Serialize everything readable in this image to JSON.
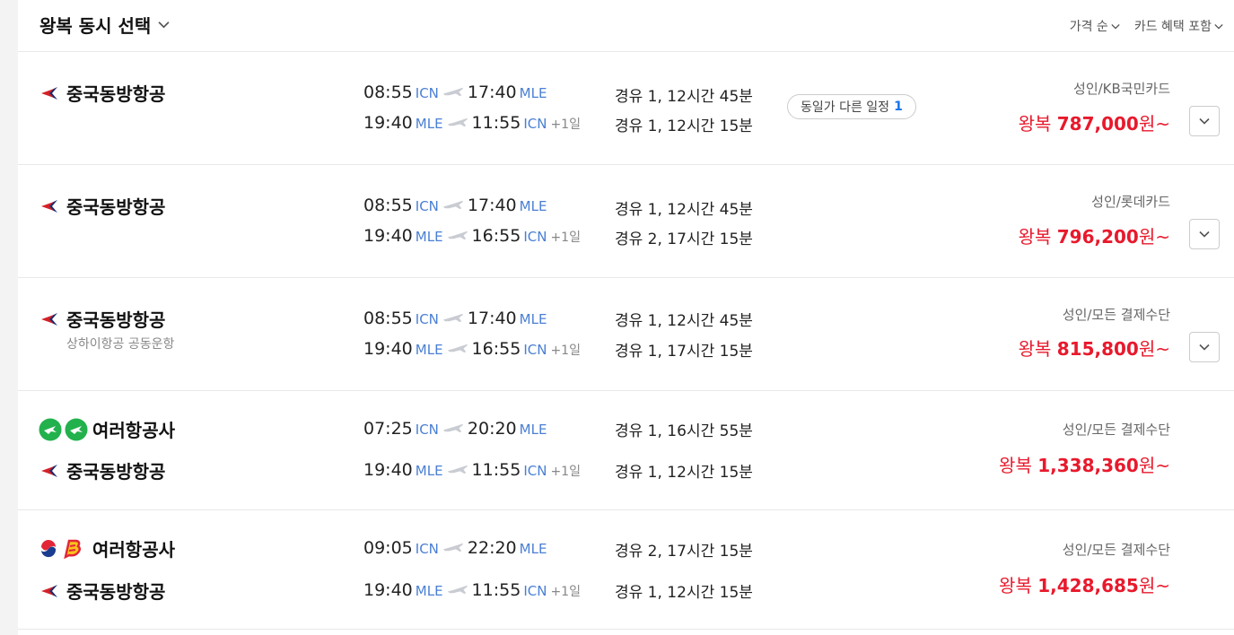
{
  "header": {
    "title": "왕복 동시 선택",
    "sort_label": "가격 순",
    "card_filter_label": "카드 혜택 포함"
  },
  "results": [
    {
      "airline": "중국동방항공",
      "outbound": {
        "dep_time": "08:55",
        "dep_code": "ICN",
        "arr_time": "17:40",
        "arr_code": "MLE",
        "plus": "",
        "stops": "경유 1, 12시간 45분"
      },
      "inbound": {
        "dep_time": "19:40",
        "dep_code": "MLE",
        "arr_time": "11:55",
        "arr_code": "ICN",
        "plus": "+1일",
        "stops": "경유 1, 12시간 15분"
      },
      "same_airline_label": "동일가 다른 일정",
      "same_airline_count": "1",
      "card": "성인/KB국민카드",
      "price_prefix": "왕복",
      "price": "787,000",
      "price_suffix": "원~"
    },
    {
      "airline": "중국동방항공",
      "outbound": {
        "dep_time": "08:55",
        "dep_code": "ICN",
        "arr_time": "17:40",
        "arr_code": "MLE",
        "plus": "",
        "stops": "경유 1, 12시간 45분"
      },
      "inbound": {
        "dep_time": "19:40",
        "dep_code": "MLE",
        "arr_time": "16:55",
        "arr_code": "ICN",
        "plus": "+1일",
        "stops": "경유 2, 17시간 15분"
      },
      "card": "성인/롯데카드",
      "price_prefix": "왕복",
      "price": "796,200",
      "price_suffix": "원~"
    },
    {
      "airline": "중국동방항공",
      "codeshare": "상하이항공 공동운항",
      "outbound": {
        "dep_time": "08:55",
        "dep_code": "ICN",
        "arr_time": "17:40",
        "arr_code": "MLE",
        "plus": "",
        "stops": "경유 1, 12시간 45분"
      },
      "inbound": {
        "dep_time": "19:40",
        "dep_code": "MLE",
        "arr_time": "16:55",
        "arr_code": "ICN",
        "plus": "+1일",
        "stops": "경유 1, 17시간 15분"
      },
      "card": "성인/모든 결제수단",
      "price_prefix": "왕복",
      "price": "815,800",
      "price_suffix": "원~"
    },
    {
      "airline_out": "여러항공사",
      "airline_in": "중국동방항공",
      "outbound": {
        "dep_time": "07:25",
        "dep_code": "ICN",
        "arr_time": "20:20",
        "arr_code": "MLE",
        "plus": "",
        "stops": "경유 1, 16시간 55분"
      },
      "inbound": {
        "dep_time": "19:40",
        "dep_code": "MLE",
        "arr_time": "11:55",
        "arr_code": "ICN",
        "plus": "+1일",
        "stops": "경유 1, 12시간 15분"
      },
      "card": "성인/모든 결제수단",
      "price_prefix": "왕복",
      "price": "1,338,360",
      "price_suffix": "원~"
    },
    {
      "airline_out": "여러항공사",
      "airline_in": "중국동방항공",
      "outbound": {
        "dep_time": "09:05",
        "dep_code": "ICN",
        "arr_time": "22:20",
        "arr_code": "MLE",
        "plus": "",
        "stops": "경유 2, 17시간 15분"
      },
      "inbound": {
        "dep_time": "19:40",
        "dep_code": "MLE",
        "arr_time": "11:55",
        "arr_code": "ICN",
        "plus": "+1일",
        "stops": "경유 1, 12시간 15분"
      },
      "card": "성인/모든 결제수단",
      "price_prefix": "왕복",
      "price": "1,428,685",
      "price_suffix": "원~"
    }
  ],
  "colors": {
    "price": "#e8192c",
    "airport_code": "#4a7fd4",
    "badge_count": "#1a73e8",
    "eastern_red": "#d42127",
    "eastern_navy": "#1c2b6b",
    "green_airline": "#22b14c"
  }
}
